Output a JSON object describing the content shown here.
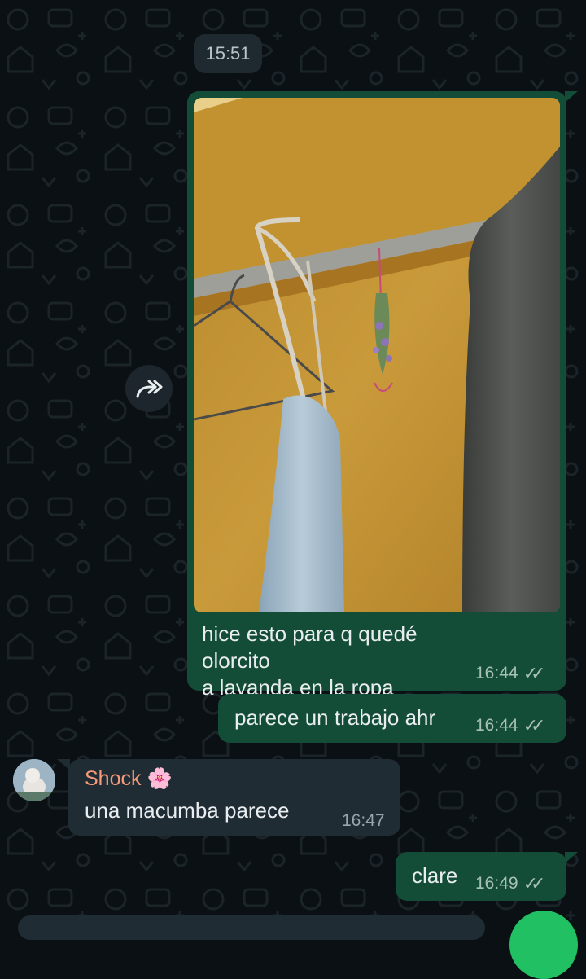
{
  "date_chip": "15:51",
  "messages": [
    {
      "type": "image",
      "direction": "outgoing",
      "caption_line1": "hice esto para q quedé olorcito",
      "caption_line2": "a lavanda en la ropa",
      "time": "16:44",
      "status_icon": "double-check-icon"
    },
    {
      "type": "text",
      "direction": "outgoing",
      "text": "parece un trabajo ahr",
      "time": "16:44",
      "status_icon": "double-check-icon"
    },
    {
      "type": "text",
      "direction": "incoming",
      "sender": "Shock",
      "sender_emoji": "🌸",
      "text": "una macumba parece",
      "time": "16:47"
    },
    {
      "type": "text",
      "direction": "outgoing",
      "text": "clare",
      "time": "16:49",
      "status_icon": "double-check-icon"
    }
  ],
  "colors": {
    "background": "#0b1014",
    "outgoing_bubble": "#134d37",
    "incoming_bubble": "#1f2c34",
    "sender_name": "#f79a7a",
    "fab": "#21c063"
  }
}
